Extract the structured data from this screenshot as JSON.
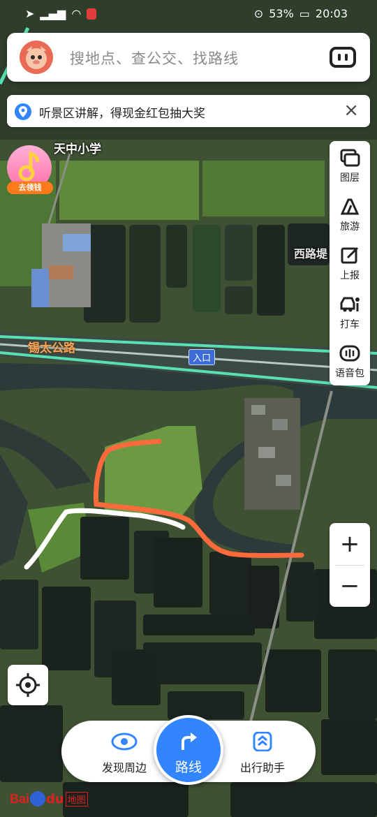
{
  "status_bar": {
    "battery": "53%",
    "time": "20:03"
  },
  "search": {
    "placeholder": "搜地点、查公交、找路线"
  },
  "banner": {
    "text": "听景区讲解，得现金红包抽大奖",
    "close": "×"
  },
  "promo": {
    "label": "去领钱"
  },
  "map_labels": {
    "school": "天中小学",
    "road": "锡太公路",
    "road_west": "西路堤",
    "entrance": "入口"
  },
  "toolbar": {
    "layers": "图层",
    "travel": "旅游",
    "report": "上报",
    "taxi": "打车",
    "voice_pack": "语音包"
  },
  "zoom": {
    "in": "+",
    "out": "−"
  },
  "bottom_nav": {
    "discover": "发现周边",
    "route": "路线",
    "assistant": "出行助手"
  },
  "logo": {
    "bai": "Bai",
    "du": "du",
    "ditu": "地图"
  },
  "colors": {
    "accent": "#3385ff",
    "route_orange": "#ff6a3d",
    "track_white": "#ffffff"
  }
}
